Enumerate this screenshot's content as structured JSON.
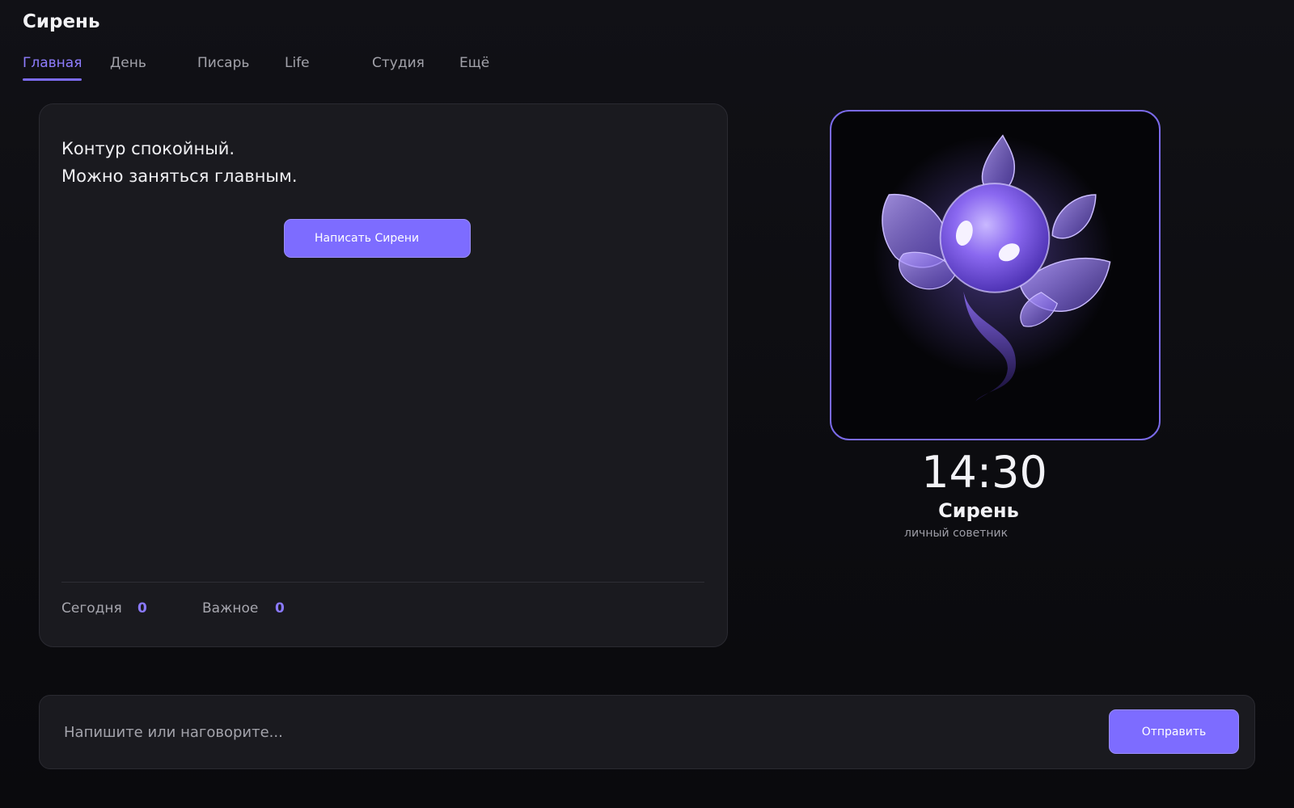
{
  "app": {
    "title": "Сирень"
  },
  "nav": {
    "tabs": [
      {
        "label": "Главная",
        "active": true
      },
      {
        "label": "День",
        "active": false
      },
      {
        "label": "Писарь",
        "active": false
      },
      {
        "label": "Life",
        "active": false
      },
      {
        "label": "Студия",
        "active": false
      },
      {
        "label": "Ещё",
        "active": false
      }
    ]
  },
  "main": {
    "status_lines": [
      "Контур спокойный.",
      "Можно заняться главным."
    ],
    "cta_label": "Написать Сирени",
    "stats": [
      {
        "label": "Сегодня",
        "value": "0"
      },
      {
        "label": "Важное",
        "value": "0"
      }
    ]
  },
  "assistant": {
    "avatar_icon": "lilac-spirit-avatar",
    "time": "14:30",
    "name": "Сирень",
    "subtitle": "личный советник"
  },
  "composer": {
    "placeholder": "Напишите или наговорите...",
    "value": "",
    "send_label": "Отправить"
  },
  "colors": {
    "accent": "#7d6cff",
    "accent_text": "#8f7dff",
    "background": "#0d0d11",
    "card": "#1a1a1f"
  }
}
